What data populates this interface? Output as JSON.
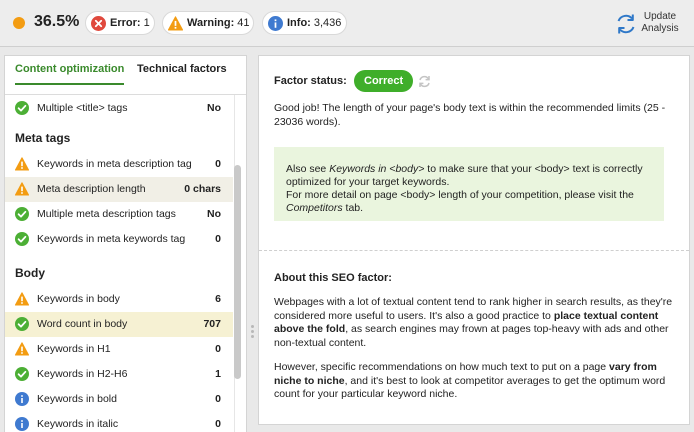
{
  "topbar": {
    "score": "36.5%",
    "error": {
      "label": "Error:",
      "count": "1"
    },
    "warning": {
      "label": "Warning:",
      "count": "41"
    },
    "info": {
      "label": "Info:",
      "count": "3,436"
    },
    "update_label": "Update\nAnalysis"
  },
  "tabs": [
    {
      "label": "Content optimization",
      "active": true
    },
    {
      "label": "Technical factors",
      "active": false
    }
  ],
  "factors": {
    "row_multiple_title": {
      "label": "Multiple <title> tags",
      "value": "No",
      "status": "ok"
    },
    "group_meta": "Meta tags",
    "meta": [
      {
        "label": "Keywords in meta description tag",
        "value": "0",
        "status": "warning"
      },
      {
        "label": "Meta description length",
        "value": "0 chars",
        "status": "warning"
      },
      {
        "label": "Multiple meta description tags",
        "value": "No",
        "status": "ok"
      },
      {
        "label": "Keywords in meta keywords tag",
        "value": "0",
        "status": "ok"
      }
    ],
    "group_body": "Body",
    "body": [
      {
        "label": "Keywords in body",
        "value": "6",
        "status": "warning"
      },
      {
        "label": "Word count in body",
        "value": "707",
        "status": "ok"
      },
      {
        "label": "Keywords in H1",
        "value": "0",
        "status": "warning"
      },
      {
        "label": "Keywords in H2-H6",
        "value": "1",
        "status": "ok"
      },
      {
        "label": "Keywords in bold",
        "value": "0",
        "status": "info"
      },
      {
        "label": "Keywords in italic",
        "value": "0",
        "status": "info"
      }
    ]
  },
  "detail": {
    "status_label": "Factor status:",
    "status_value": "Correct",
    "message": "Good job! The length of your page's body text is within the recommended limits (25 - 23036 words).",
    "note": {
      "l1_a": "Also see ",
      "l1_em": "Keywords in <body>",
      "l1_b": " to make sure that your <body> text is correctly optimized for your target keywords.",
      "l2_a": "For more detail on page <body> length of your competition, please visit the ",
      "l2_em": "Competitors",
      "l2_b": " tab."
    },
    "about_title": "About this SEO factor:",
    "p1_a": "Webpages with a lot of textual content tend to rank higher in search results, as they're considered more useful to users. It's also a good practice to ",
    "p1_b": "place textual content above the fold",
    "p1_c": ", as search engines may frown at pages top-heavy with ads and other non-textual content.",
    "p2_a": "However, specific recommendations on how much text to put on a page ",
    "p2_b": "vary from niche to niche",
    "p2_c": ", and it's best to look at competitor averages to get the optimum word count for your particular keyword niche."
  },
  "colors": {
    "ok": "#4caf35",
    "warning": "#f39c12",
    "error": "#e0493d",
    "info": "#3f7ad0",
    "accent": "#3a8a2c"
  }
}
